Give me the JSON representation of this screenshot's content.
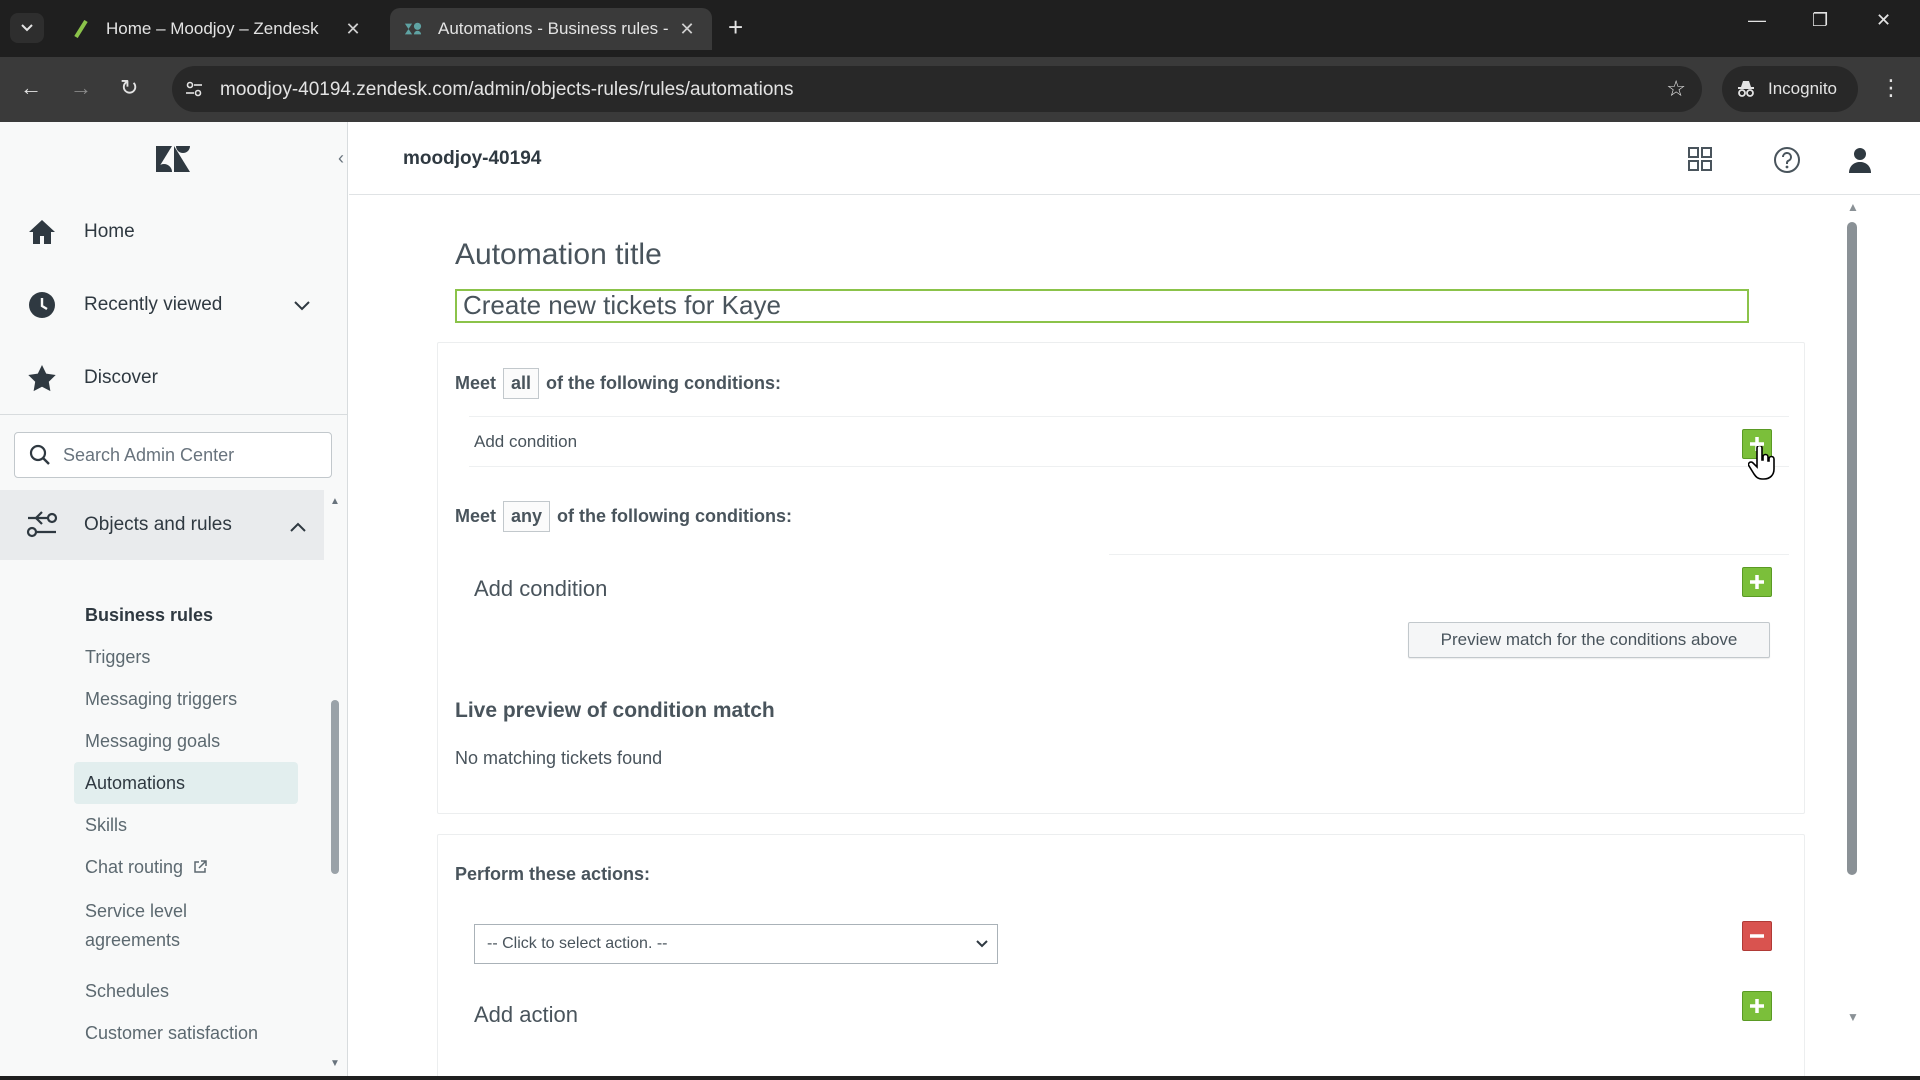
{
  "browser": {
    "tabs": [
      {
        "title": "Home – Moodjoy – Zendesk",
        "active": false
      },
      {
        "title": "Automations - Business rules -",
        "active": true
      }
    ],
    "url": "moodjoy-40194.zendesk.com/admin/objects-rules/rules/automations",
    "incognito_label": "Incognito"
  },
  "sidebar": {
    "nav": [
      {
        "label": "Home",
        "icon": "home-icon"
      },
      {
        "label": "Recently viewed",
        "icon": "clock-icon"
      },
      {
        "label": "Discover",
        "icon": "star-icon"
      }
    ],
    "search_placeholder": "Search Admin Center",
    "section": {
      "label": "Objects and rules",
      "icon": "objects-rules-icon"
    },
    "subsection_header": "Business rules",
    "sub_items": [
      {
        "label": "Triggers"
      },
      {
        "label": "Messaging triggers"
      },
      {
        "label": "Messaging goals"
      },
      {
        "label": "Automations",
        "active": true
      },
      {
        "label": "Skills"
      },
      {
        "label": "Chat routing"
      },
      {
        "label": "Service level"
      },
      {
        "label": "agreements"
      },
      {
        "label": "Schedules"
      },
      {
        "label": "Customer satisfaction"
      }
    ]
  },
  "topbar": {
    "account_name": "moodjoy-40194"
  },
  "form": {
    "title_heading": "Automation title",
    "title_value": "Create new tickets for Kaye",
    "all_conditions": {
      "prefix": "Meet",
      "selector": "all",
      "suffix": "of the following conditions:",
      "add_label": "Add condition"
    },
    "any_conditions": {
      "prefix": "Meet",
      "selector": "any",
      "suffix": "of the following conditions:",
      "add_label": "Add condition"
    },
    "preview_button": "Preview match for the conditions above",
    "live_preview_heading": "Live preview of condition match",
    "no_match_text": "No matching tickets found",
    "actions_heading": "Perform these actions:",
    "action_select_value": "-- Click to select action. --",
    "add_action_label": "Add action"
  },
  "colors": {
    "accent_green": "#7bbf3a",
    "remove_red": "#d9534f",
    "active_nav_bg": "#e2eeee"
  }
}
